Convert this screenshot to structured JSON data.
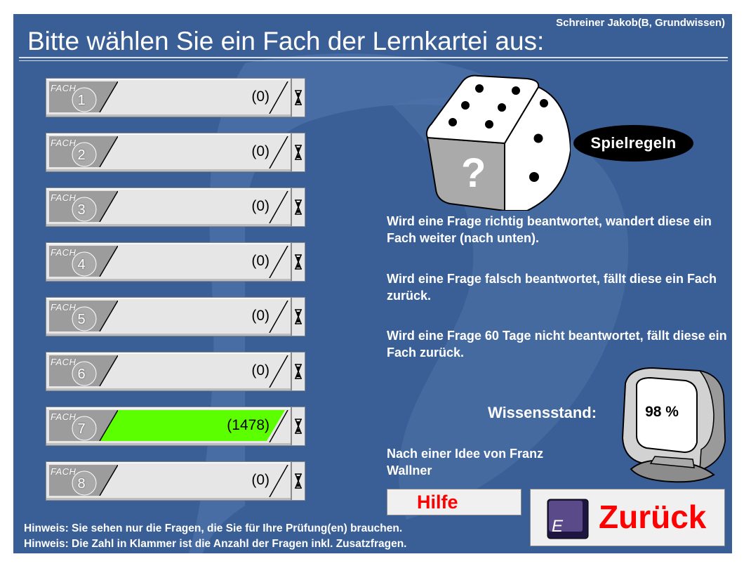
{
  "header": {
    "user": "Schreiner Jakob(B, Grundwissen)",
    "title": "Bitte wählen Sie ein Fach der Lernkartei aus:"
  },
  "boxes": [
    {
      "word": "FACH",
      "number": "1",
      "count": "(0)",
      "fill_fraction": 0
    },
    {
      "word": "FACH",
      "number": "2",
      "count": "(0)",
      "fill_fraction": 0
    },
    {
      "word": "FACH",
      "number": "3",
      "count": "(0)",
      "fill_fraction": 0
    },
    {
      "word": "FACH",
      "number": "4",
      "count": "(0)",
      "fill_fraction": 0
    },
    {
      "word": "FACH",
      "number": "5",
      "count": "(0)",
      "fill_fraction": 0
    },
    {
      "word": "FACH",
      "number": "6",
      "count": "(0)",
      "fill_fraction": 0
    },
    {
      "word": "FACH",
      "number": "7",
      "count": "(1478)",
      "fill_fraction": 1
    },
    {
      "word": "FACH",
      "number": "8",
      "count": "(0)",
      "fill_fraction": 0
    }
  ],
  "rules": {
    "button_label": "Spielregeln",
    "dice_face": "?",
    "text_correct": "Wird eine Frage richtig beantwortet, wandert diese ein Fach weiter (nach unten).",
    "text_wrong": "Wird eine Frage falsch beantwortet, fällt diese ein Fach zurück.",
    "text_timeout": "Wird eine Frage 60 Tage nicht beantwortet, fällt diese ein Fach zurück."
  },
  "knowledge": {
    "label": "Wissensstand:",
    "value": "98 %"
  },
  "credit": "Nach einer Idee von Franz Wallner",
  "buttons": {
    "help": "Hilfe",
    "back": "Zurück",
    "back_key": "E"
  },
  "hints": [
    "Hinweis: Sie sehen nur die Fragen, die Sie für Ihre Prüfung(en) brauchen.",
    "Hinweis: Die Zahl in Klammer ist die Anzahl der Fragen inkl. Zusatzfragen."
  ],
  "colors": {
    "background": "#3a5f96",
    "fill_active": "#5cff00",
    "accent_red": "#ff0000"
  }
}
